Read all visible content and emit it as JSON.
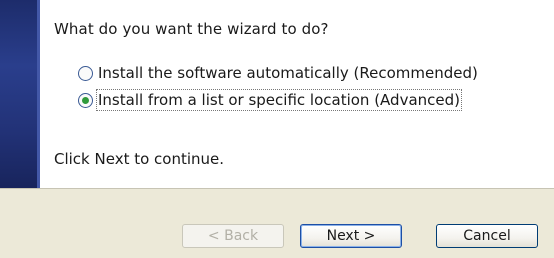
{
  "wizard": {
    "question": "What do you want the wizard to do?",
    "options": [
      {
        "label": "Install the software automatically (Recommended)",
        "selected": false
      },
      {
        "label": "Install from a list or specific location (Advanced)",
        "selected": true
      }
    ],
    "continue_text": "Click Next to continue."
  },
  "buttons": {
    "back": "< Back",
    "next": "Next >",
    "cancel": "Cancel"
  },
  "colors": {
    "banner": "#1d2c6b",
    "footer": "#ece9d8",
    "radio_dot": "#2f9a3a",
    "button_border": "#003c74"
  }
}
